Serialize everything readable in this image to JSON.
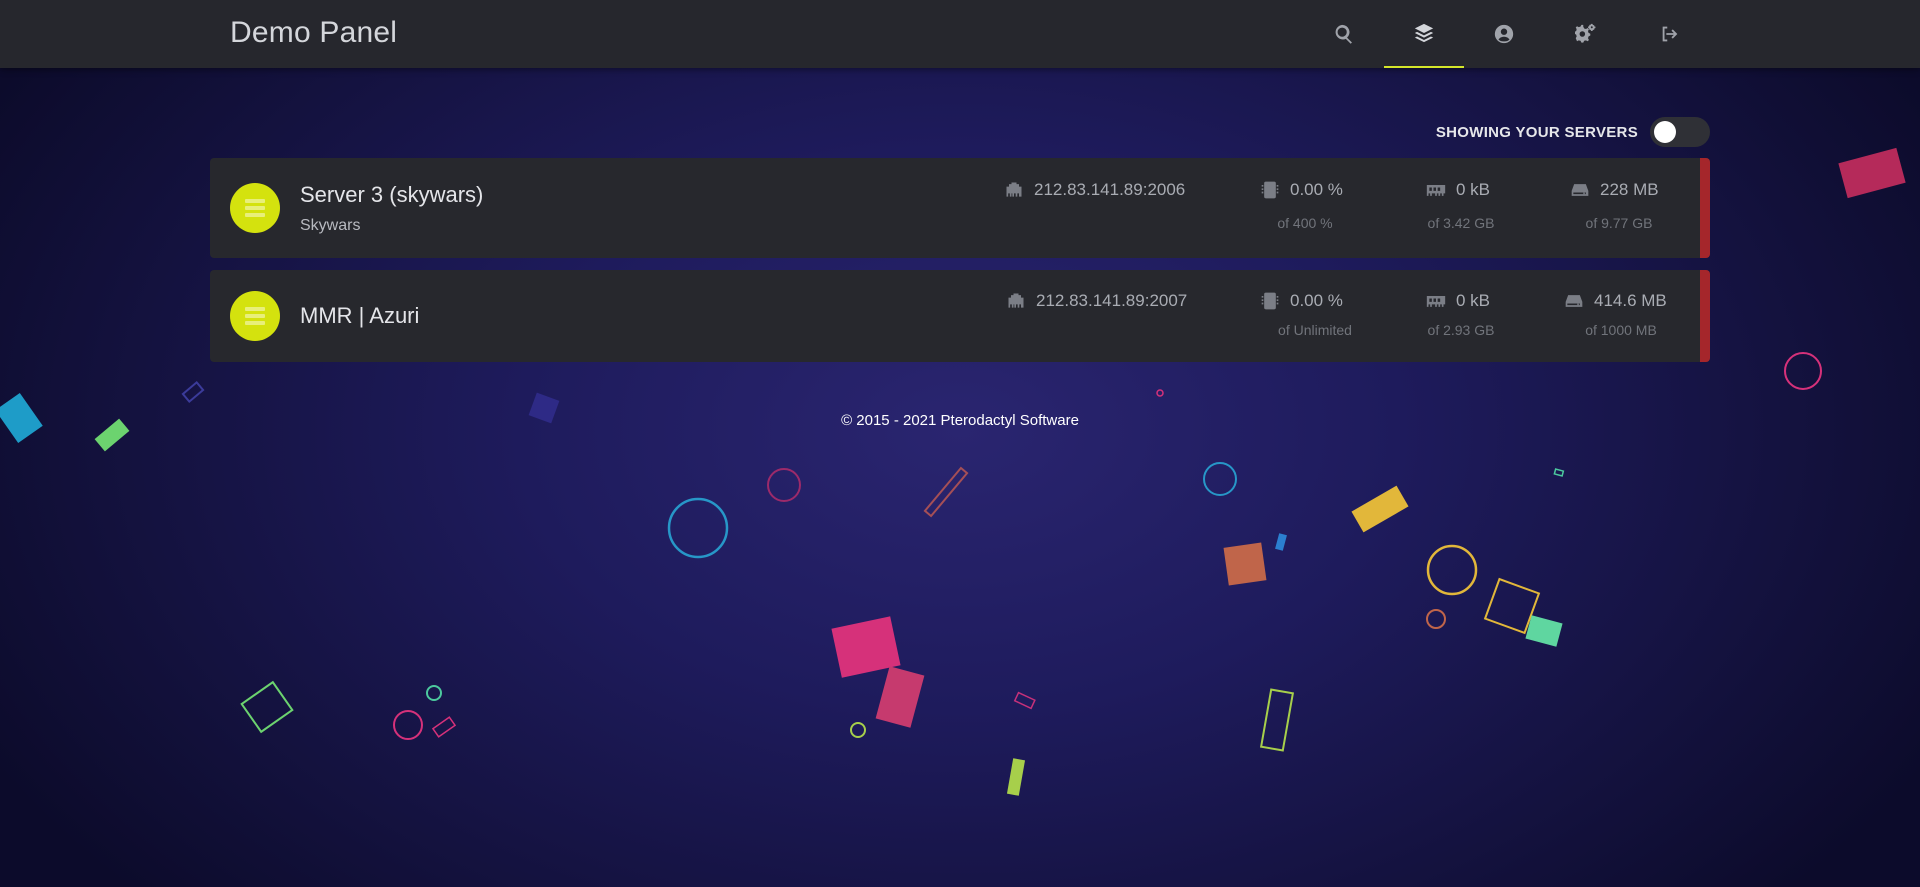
{
  "header": {
    "title": "Demo Panel",
    "nav": [
      {
        "icon": "search-icon",
        "active": false
      },
      {
        "icon": "layers-icon",
        "active": true
      },
      {
        "icon": "user-circle-icon",
        "active": false
      },
      {
        "icon": "cogs-icon",
        "active": false
      },
      {
        "icon": "sign-out-icon",
        "active": false
      }
    ]
  },
  "filter": {
    "label": "Showing your servers",
    "toggle_on": false
  },
  "servers": [
    {
      "name": "Server 3 (skywars)",
      "description": "Skywars",
      "address": "212.83.141.89:2006",
      "cpu": "0.00 %",
      "cpu_limit": "of 400 %",
      "memory": "0 kB",
      "memory_limit": "of 3.42 GB",
      "disk": "228 MB",
      "disk_limit": "of 9.77 GB",
      "status_color": "#a5262b"
    },
    {
      "name": "MMR | Azuri",
      "description": "",
      "address": "212.83.141.89:2007",
      "cpu": "0.00 %",
      "cpu_limit": "of Unlimited",
      "memory": "0 kB",
      "memory_limit": "of 2.93 GB",
      "disk": "414.6 MB",
      "disk_limit": "of 1000 MB",
      "status_color": "#a5262b"
    }
  ],
  "footer": {
    "copyright": "© 2015 - 2021 Pterodactyl Software"
  },
  "colors": {
    "accent": "#d4e20e",
    "status_offline": "#a5262b",
    "topbar": "#26272d",
    "card": "#27282d"
  }
}
